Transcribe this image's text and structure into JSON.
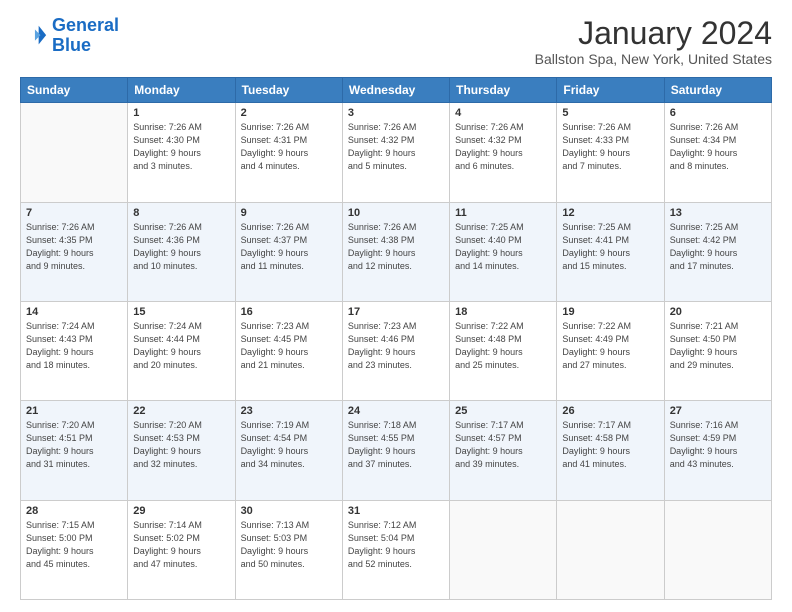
{
  "logo": {
    "text_general": "General",
    "text_blue": "Blue"
  },
  "header": {
    "month": "January 2024",
    "location": "Ballston Spa, New York, United States"
  },
  "days_of_week": [
    "Sunday",
    "Monday",
    "Tuesday",
    "Wednesday",
    "Thursday",
    "Friday",
    "Saturday"
  ],
  "weeks": [
    [
      {
        "day": "",
        "info": ""
      },
      {
        "day": "1",
        "info": "Sunrise: 7:26 AM\nSunset: 4:30 PM\nDaylight: 9 hours\nand 3 minutes."
      },
      {
        "day": "2",
        "info": "Sunrise: 7:26 AM\nSunset: 4:31 PM\nDaylight: 9 hours\nand 4 minutes."
      },
      {
        "day": "3",
        "info": "Sunrise: 7:26 AM\nSunset: 4:32 PM\nDaylight: 9 hours\nand 5 minutes."
      },
      {
        "day": "4",
        "info": "Sunrise: 7:26 AM\nSunset: 4:32 PM\nDaylight: 9 hours\nand 6 minutes."
      },
      {
        "day": "5",
        "info": "Sunrise: 7:26 AM\nSunset: 4:33 PM\nDaylight: 9 hours\nand 7 minutes."
      },
      {
        "day": "6",
        "info": "Sunrise: 7:26 AM\nSunset: 4:34 PM\nDaylight: 9 hours\nand 8 minutes."
      }
    ],
    [
      {
        "day": "7",
        "info": "Sunrise: 7:26 AM\nSunset: 4:35 PM\nDaylight: 9 hours\nand 9 minutes."
      },
      {
        "day": "8",
        "info": "Sunrise: 7:26 AM\nSunset: 4:36 PM\nDaylight: 9 hours\nand 10 minutes."
      },
      {
        "day": "9",
        "info": "Sunrise: 7:26 AM\nSunset: 4:37 PM\nDaylight: 9 hours\nand 11 minutes."
      },
      {
        "day": "10",
        "info": "Sunrise: 7:26 AM\nSunset: 4:38 PM\nDaylight: 9 hours\nand 12 minutes."
      },
      {
        "day": "11",
        "info": "Sunrise: 7:25 AM\nSunset: 4:40 PM\nDaylight: 9 hours\nand 14 minutes."
      },
      {
        "day": "12",
        "info": "Sunrise: 7:25 AM\nSunset: 4:41 PM\nDaylight: 9 hours\nand 15 minutes."
      },
      {
        "day": "13",
        "info": "Sunrise: 7:25 AM\nSunset: 4:42 PM\nDaylight: 9 hours\nand 17 minutes."
      }
    ],
    [
      {
        "day": "14",
        "info": "Sunrise: 7:24 AM\nSunset: 4:43 PM\nDaylight: 9 hours\nand 18 minutes."
      },
      {
        "day": "15",
        "info": "Sunrise: 7:24 AM\nSunset: 4:44 PM\nDaylight: 9 hours\nand 20 minutes."
      },
      {
        "day": "16",
        "info": "Sunrise: 7:23 AM\nSunset: 4:45 PM\nDaylight: 9 hours\nand 21 minutes."
      },
      {
        "day": "17",
        "info": "Sunrise: 7:23 AM\nSunset: 4:46 PM\nDaylight: 9 hours\nand 23 minutes."
      },
      {
        "day": "18",
        "info": "Sunrise: 7:22 AM\nSunset: 4:48 PM\nDaylight: 9 hours\nand 25 minutes."
      },
      {
        "day": "19",
        "info": "Sunrise: 7:22 AM\nSunset: 4:49 PM\nDaylight: 9 hours\nand 27 minutes."
      },
      {
        "day": "20",
        "info": "Sunrise: 7:21 AM\nSunset: 4:50 PM\nDaylight: 9 hours\nand 29 minutes."
      }
    ],
    [
      {
        "day": "21",
        "info": "Sunrise: 7:20 AM\nSunset: 4:51 PM\nDaylight: 9 hours\nand 31 minutes."
      },
      {
        "day": "22",
        "info": "Sunrise: 7:20 AM\nSunset: 4:53 PM\nDaylight: 9 hours\nand 32 minutes."
      },
      {
        "day": "23",
        "info": "Sunrise: 7:19 AM\nSunset: 4:54 PM\nDaylight: 9 hours\nand 34 minutes."
      },
      {
        "day": "24",
        "info": "Sunrise: 7:18 AM\nSunset: 4:55 PM\nDaylight: 9 hours\nand 37 minutes."
      },
      {
        "day": "25",
        "info": "Sunrise: 7:17 AM\nSunset: 4:57 PM\nDaylight: 9 hours\nand 39 minutes."
      },
      {
        "day": "26",
        "info": "Sunrise: 7:17 AM\nSunset: 4:58 PM\nDaylight: 9 hours\nand 41 minutes."
      },
      {
        "day": "27",
        "info": "Sunrise: 7:16 AM\nSunset: 4:59 PM\nDaylight: 9 hours\nand 43 minutes."
      }
    ],
    [
      {
        "day": "28",
        "info": "Sunrise: 7:15 AM\nSunset: 5:00 PM\nDaylight: 9 hours\nand 45 minutes."
      },
      {
        "day": "29",
        "info": "Sunrise: 7:14 AM\nSunset: 5:02 PM\nDaylight: 9 hours\nand 47 minutes."
      },
      {
        "day": "30",
        "info": "Sunrise: 7:13 AM\nSunset: 5:03 PM\nDaylight: 9 hours\nand 50 minutes."
      },
      {
        "day": "31",
        "info": "Sunrise: 7:12 AM\nSunset: 5:04 PM\nDaylight: 9 hours\nand 52 minutes."
      },
      {
        "day": "",
        "info": ""
      },
      {
        "day": "",
        "info": ""
      },
      {
        "day": "",
        "info": ""
      }
    ]
  ]
}
